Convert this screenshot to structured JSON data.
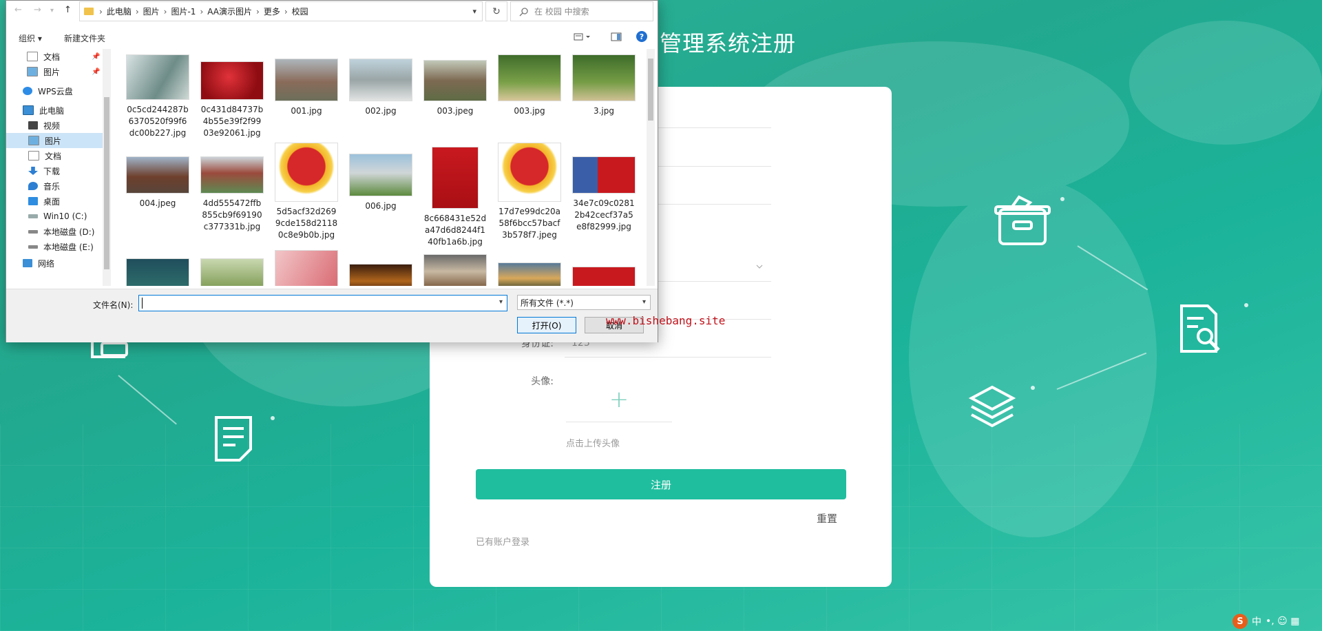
{
  "page": {
    "title": "管理系统注册",
    "form": {
      "id_label": "身份证:",
      "id_value": "123",
      "avatar_label": "头像:",
      "upload_plus": "+",
      "upload_tip": "点击上传头像",
      "register_btn": "注册",
      "reset_link": "重置",
      "login_link": "已有账户登录"
    }
  },
  "dialog": {
    "nav_back": "←",
    "nav_forward": "→",
    "nav_up": "↑",
    "path": [
      "此电脑",
      "图片",
      "图片-1",
      "AA演示图片",
      "更多",
      "校园"
    ],
    "path_sep": "›",
    "refresh_icon": "↻",
    "search_placeholder": "在 校园 中搜索",
    "toolbar": {
      "organize": "组织 ▾",
      "new_folder": "新建文件夹",
      "help": "?"
    },
    "nav_items": [
      {
        "label": "文档",
        "pinned": true
      },
      {
        "label": "图片",
        "pinned": true
      },
      {
        "label": "WPS云盘"
      },
      {
        "label": "此电脑"
      },
      {
        "label": "视频"
      },
      {
        "label": "图片",
        "selected": true
      },
      {
        "label": "文档"
      },
      {
        "label": "下载"
      },
      {
        "label": "音乐"
      },
      {
        "label": "桌面"
      },
      {
        "label": "Win10 (C:)"
      },
      {
        "label": "本地磁盘 (D:)"
      },
      {
        "label": "本地磁盘 (E:)"
      },
      {
        "label": "网络"
      }
    ],
    "pin_glyph": "📌",
    "files": [
      "0c5cd244287b6370520f99f6dc00b227.jpg",
      "0c431d84737b4b55e39f2f9903e92061.jpg",
      "001.jpg",
      "002.jpg",
      "003.jpeg",
      "003.jpg",
      "3.jpg",
      "004.jpeg",
      "4dd555472ffb855cb9f69190c377331b.jpg",
      "5d5acf32d2699cde158d21180c8e9b0b.jpg",
      "006.jpg",
      "8c668431e52da47d6d8244f140fb1a6b.jpg",
      "17d7e99dc20a58f6bcc57bacf3b578f7.jpeg",
      "34e7c09c02812b42cecf37a5e8f82999.jpg"
    ],
    "filename_label": "文件名(N):",
    "filename_value": "",
    "filter_value": "所有文件 (*.*)",
    "open_btn": "打开(O)",
    "cancel_btn": "取消",
    "dropdown_glyph": "▾"
  },
  "watermark": "www.bishebang.site",
  "ime": {
    "logo": "S",
    "lang": "中",
    "extra": "•, ☺ ▦"
  }
}
